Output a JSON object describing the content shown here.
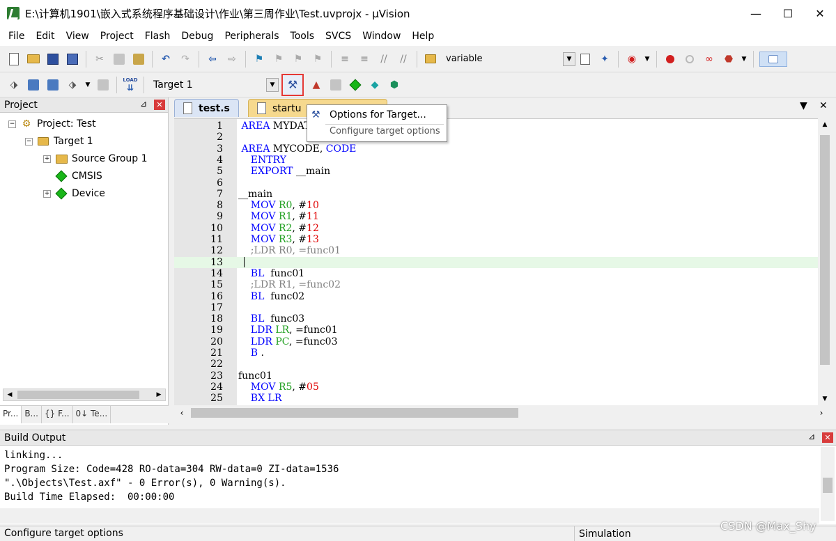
{
  "window": {
    "title": "E:\\计算机1901\\嵌入式系统程序基础设计\\作业\\第三周作业\\Test.uvprojx - µVision",
    "minimize": "—",
    "maximize": "☐",
    "close": "✕"
  },
  "menu": [
    "File",
    "Edit",
    "View",
    "Project",
    "Flash",
    "Debug",
    "Peripherals",
    "Tools",
    "SVCS",
    "Window",
    "Help"
  ],
  "toolbar1": {
    "find_value": "variable"
  },
  "toolbar2": {
    "target_value": "Target 1",
    "load_label": "LOAD"
  },
  "project_panel": {
    "title": "Project",
    "pin": "⊿",
    "close": "✕",
    "tree": {
      "root": "Project: Test",
      "target": "Target 1",
      "group": "Source Group 1",
      "cmsis": "CMSIS",
      "device": "Device"
    },
    "tabs": [
      "Pr...",
      "B...",
      "{} F...",
      "0↓ Te..."
    ]
  },
  "editor": {
    "tabs": [
      "test.s",
      "startup_ARMCM3.s"
    ],
    "tab2_visible": "startu",
    "tab2_tail": "..."
  },
  "code_lines": [
    {
      "n": "1",
      "parts": [
        [
          "kw",
          " AREA "
        ],
        [
          "",
          "MYDATA"
        ]
      ]
    },
    {
      "n": "2",
      "parts": []
    },
    {
      "n": "3",
      "parts": [
        [
          "kw",
          " AREA "
        ],
        [
          "",
          "MYCODE, "
        ],
        [
          "kw",
          "CODE"
        ]
      ]
    },
    {
      "n": "4",
      "parts": [
        [
          "kw",
          "    ENTRY"
        ]
      ]
    },
    {
      "n": "5",
      "parts": [
        [
          "kw",
          "    EXPORT "
        ],
        [
          "",
          "__main"
        ]
      ]
    },
    {
      "n": "6",
      "parts": []
    },
    {
      "n": "7",
      "parts": [
        [
          "",
          "__main"
        ]
      ]
    },
    {
      "n": "8",
      "parts": [
        [
          "kw",
          "    MOV "
        ],
        [
          "reg",
          "R0"
        ],
        [
          "",
          ", #"
        ],
        [
          "num",
          "10"
        ]
      ]
    },
    {
      "n": "9",
      "parts": [
        [
          "kw",
          "    MOV "
        ],
        [
          "reg",
          "R1"
        ],
        [
          "",
          ", #"
        ],
        [
          "num",
          "11"
        ]
      ]
    },
    {
      "n": "10",
      "parts": [
        [
          "kw",
          "    MOV "
        ],
        [
          "reg",
          "R2"
        ],
        [
          "",
          ", #"
        ],
        [
          "num",
          "12"
        ]
      ]
    },
    {
      "n": "11",
      "parts": [
        [
          "kw",
          "    MOV "
        ],
        [
          "reg",
          "R3"
        ],
        [
          "",
          ", #"
        ],
        [
          "num",
          "13"
        ]
      ]
    },
    {
      "n": "12",
      "parts": [
        [
          "cmt",
          "    ;LDR R0, =func01"
        ]
      ]
    },
    {
      "n": "13",
      "parts": []
    },
    {
      "n": "14",
      "parts": [
        [
          "kw",
          "    BL  "
        ],
        [
          "",
          "func01"
        ]
      ]
    },
    {
      "n": "15",
      "parts": [
        [
          "cmt",
          "    ;LDR R1, =func02"
        ]
      ]
    },
    {
      "n": "16",
      "parts": [
        [
          "kw",
          "    BL  "
        ],
        [
          "",
          "func02"
        ]
      ]
    },
    {
      "n": "17",
      "parts": []
    },
    {
      "n": "18",
      "parts": [
        [
          "kw",
          "    BL  "
        ],
        [
          "",
          "func03"
        ]
      ]
    },
    {
      "n": "19",
      "parts": [
        [
          "kw",
          "    LDR "
        ],
        [
          "reg",
          "LR"
        ],
        [
          "",
          ", =func01"
        ]
      ]
    },
    {
      "n": "20",
      "parts": [
        [
          "kw",
          "    LDR "
        ],
        [
          "reg",
          "PC"
        ],
        [
          "",
          ", =func03"
        ]
      ]
    },
    {
      "n": "21",
      "parts": [
        [
          "kw",
          "    B "
        ],
        [
          "",
          "."
        ]
      ]
    },
    {
      "n": "22",
      "parts": []
    },
    {
      "n": "23",
      "parts": [
        [
          "",
          "func01"
        ]
      ]
    },
    {
      "n": "24",
      "parts": [
        [
          "kw",
          "    MOV "
        ],
        [
          "reg",
          "R5"
        ],
        [
          "",
          ", #"
        ],
        [
          "num",
          "05"
        ]
      ]
    },
    {
      "n": "25",
      "parts": [
        [
          "kw",
          "    BX "
        ],
        [
          "kw",
          "LR"
        ]
      ]
    }
  ],
  "current_line": 13,
  "tooltip": {
    "title": "Options for Target...",
    "description": "Configure target options"
  },
  "build_output": {
    "title": "Build Output",
    "lines": [
      "linking...",
      "Program Size: Code=428 RO-data=304 RW-data=0 ZI-data=1536",
      "\".\\Objects\\Test.axf\" - 0 Error(s), 0 Warning(s).",
      "Build Time Elapsed:  00:00:00"
    ]
  },
  "status": {
    "left": "Configure target options",
    "mode": "Simulation"
  },
  "watermark": "CSDN @Max_Shy",
  "colors": {
    "highlight_box": "#e53935",
    "keyword": "#0000ff",
    "register": "#22a022",
    "number": "#e00000",
    "comment": "#808080"
  }
}
